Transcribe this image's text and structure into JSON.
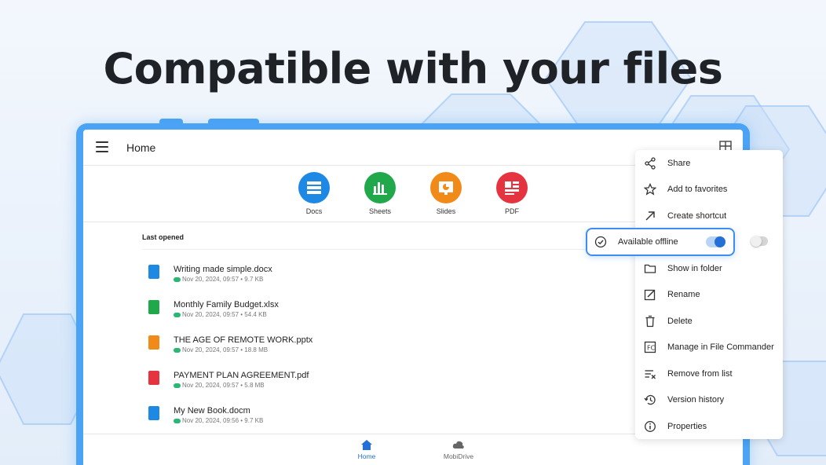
{
  "headline": "Compatible with your files",
  "topbar": {
    "title": "Home"
  },
  "categories": [
    {
      "label": "Docs",
      "color": "#1e88e5",
      "icon": "docs-icon"
    },
    {
      "label": "Sheets",
      "color": "#21a84a",
      "icon": "sheets-icon"
    },
    {
      "label": "Slides",
      "color": "#f28a1a",
      "icon": "slides-icon"
    },
    {
      "label": "PDF",
      "color": "#e53340",
      "icon": "pdf-icon"
    }
  ],
  "last_opened": {
    "title": "Last opened",
    "files": [
      {
        "name": "Writing made simple.docx",
        "meta": "Nov 20, 2024, 09:57 • 9.7 KB",
        "color": "#1e88e5",
        "icon": "doc-file-icon"
      },
      {
        "name": "Monthly Family Budget.xlsx",
        "meta": "Nov 20, 2024, 09:57 • 54.4 KB",
        "color": "#21a84a",
        "icon": "sheet-file-icon"
      },
      {
        "name": "THE AGE OF REMOTE WORK.pptx",
        "meta": "Nov 20, 2024, 09:57 • 18.8 MB",
        "color": "#f28a1a",
        "icon": "slide-file-icon"
      },
      {
        "name": "PAYMENT PLAN AGREEMENT.pdf",
        "meta": "Nov 20, 2024, 09:57 • 5.8 MB",
        "color": "#e53340",
        "icon": "pdf-file-icon"
      },
      {
        "name": "My New Book.docm",
        "meta": "Nov 20, 2024, 09:56 • 9.7 KB",
        "color": "#1e88e5",
        "icon": "doc-file-icon"
      }
    ]
  },
  "bottom_nav": [
    {
      "label": "Home",
      "active": true,
      "icon": "home-icon"
    },
    {
      "label": "MobiDrive",
      "active": false,
      "icon": "cloud-icon"
    }
  ],
  "context_menu": {
    "items": [
      {
        "label": "Share",
        "icon": "share-icon"
      },
      {
        "label": "Add to favorites",
        "icon": "star-icon"
      },
      {
        "label": "Create shortcut",
        "icon": "arrow-up-right-icon"
      },
      {
        "label": "Show in folder",
        "icon": "folder-icon"
      },
      {
        "label": "Rename",
        "icon": "edit-icon"
      },
      {
        "label": "Delete",
        "icon": "trash-icon"
      },
      {
        "label": "Manage in File Commander",
        "icon": "file-commander-icon"
      },
      {
        "label": "Remove from list",
        "icon": "remove-list-icon"
      },
      {
        "label": "Version history",
        "icon": "history-icon"
      },
      {
        "label": "Properties",
        "icon": "info-icon"
      }
    ],
    "offline": {
      "label": "Available offline",
      "enabled": true,
      "icon": "check-circle-icon"
    }
  },
  "colors": {
    "accent": "#2470d6",
    "frame": "#4aa3f4",
    "highlight": "#3d8ef0"
  }
}
